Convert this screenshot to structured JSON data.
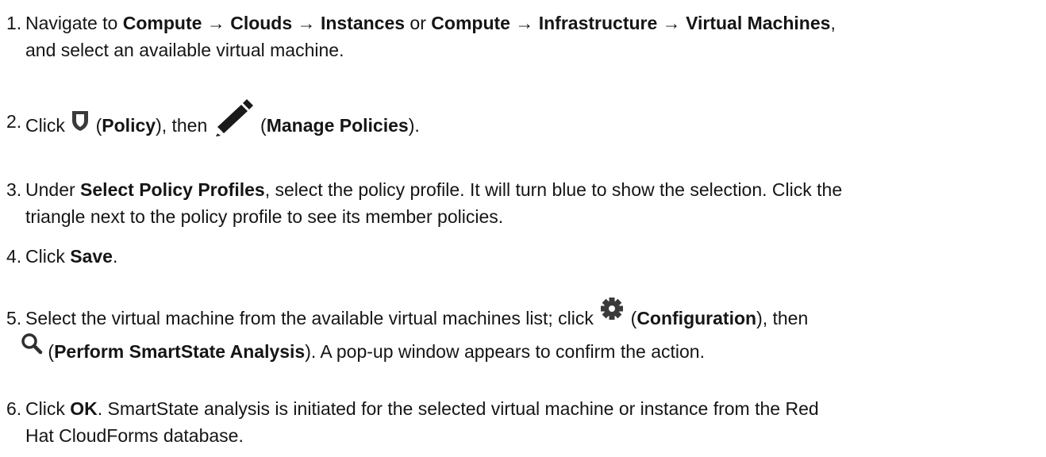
{
  "steps": [
    {
      "number": "1.",
      "t1": "Navigate to ",
      "b1": "Compute",
      "arrow1": " → ",
      "b2": "Clouds",
      "arrow2": " → ",
      "b3": "Instances",
      "t2": " or ",
      "b4": "Compute",
      "arrow3": " → ",
      "b5": "Infrastructure",
      "arrow4": " → ",
      "b6": "Virtual Machines",
      "t3": ",",
      "line2": "and select an available virtual machine."
    },
    {
      "number": "2.",
      "t1": "Click ",
      "icon1": "shield-icon",
      "t2": " (",
      "b1": "Policy",
      "t3": "), then ",
      "icon2": "pencil-icon",
      "t4": " (",
      "b2": "Manage Policies",
      "t5": ")."
    },
    {
      "number": "3.",
      "t1": "Under ",
      "b1": "Select Policy Profiles",
      "t2": ", select the policy profile. It will turn blue to show the selection. Click the",
      "line2": "triangle next to the policy profile to see its member policies."
    },
    {
      "number": "4.",
      "t1": "Click ",
      "b1": "Save",
      "t2": "."
    },
    {
      "number": "5.",
      "t1": "Select the virtual machine from the available virtual machines list; click ",
      "icon1": "gear-icon",
      "t2": " (",
      "b1": "Configuration",
      "t3": "), then",
      "icon2": "search-icon",
      "t4": " (",
      "b2": "Perform SmartState Analysis",
      "t5": "). A pop-up window appears to confirm the action."
    },
    {
      "number": "6.",
      "t1": "Click ",
      "b1": "OK",
      "t2": ". SmartState analysis is initiated for the selected virtual machine or instance from the Red",
      "line2": "Hat CloudForms database."
    }
  ]
}
